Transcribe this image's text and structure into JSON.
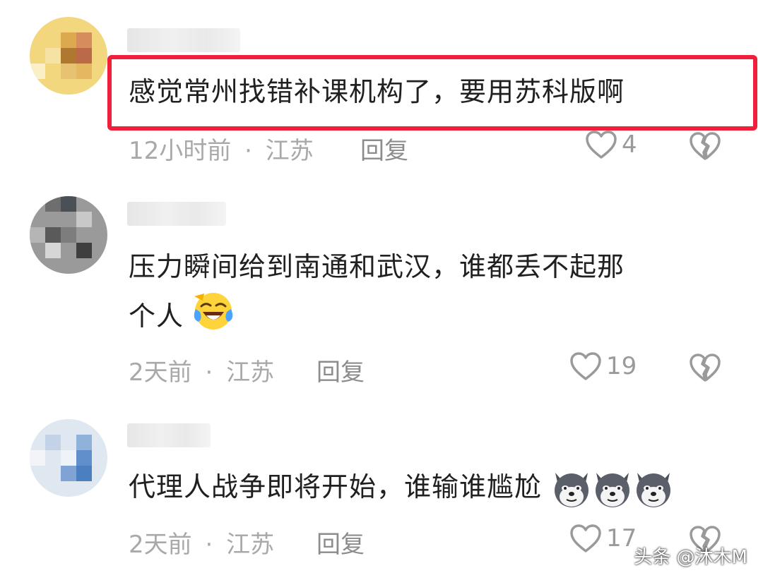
{
  "comments": [
    {
      "text_lines": [
        "感觉常州找错补课机构了，要用苏科版啊"
      ],
      "time": "12小时前",
      "separator": "·",
      "location": "江苏",
      "reply_label": "回复",
      "likes": "4",
      "emoji": []
    },
    {
      "text_lines": [
        "压力瞬间给到南通和武汉，谁都丢不起那",
        "个人"
      ],
      "time": "2天前",
      "separator": "·",
      "location": "江苏",
      "reply_label": "回复",
      "likes": "19",
      "emoji": [
        "laugh-cry-emoji"
      ]
    },
    {
      "text_lines": [
        "代理人战争即将开始，谁输谁尴尬"
      ],
      "time": "2天前",
      "separator": "·",
      "location": "江苏",
      "reply_label": "回复",
      "likes": "17",
      "emoji": [
        "husky-emoji",
        "husky-emoji",
        "husky-emoji"
      ]
    }
  ],
  "watermark": "头条 @沐木M",
  "colors": {
    "highlight_border": "#f0203a",
    "meta_text": "#a9a9a9",
    "body_text": "#202020"
  }
}
